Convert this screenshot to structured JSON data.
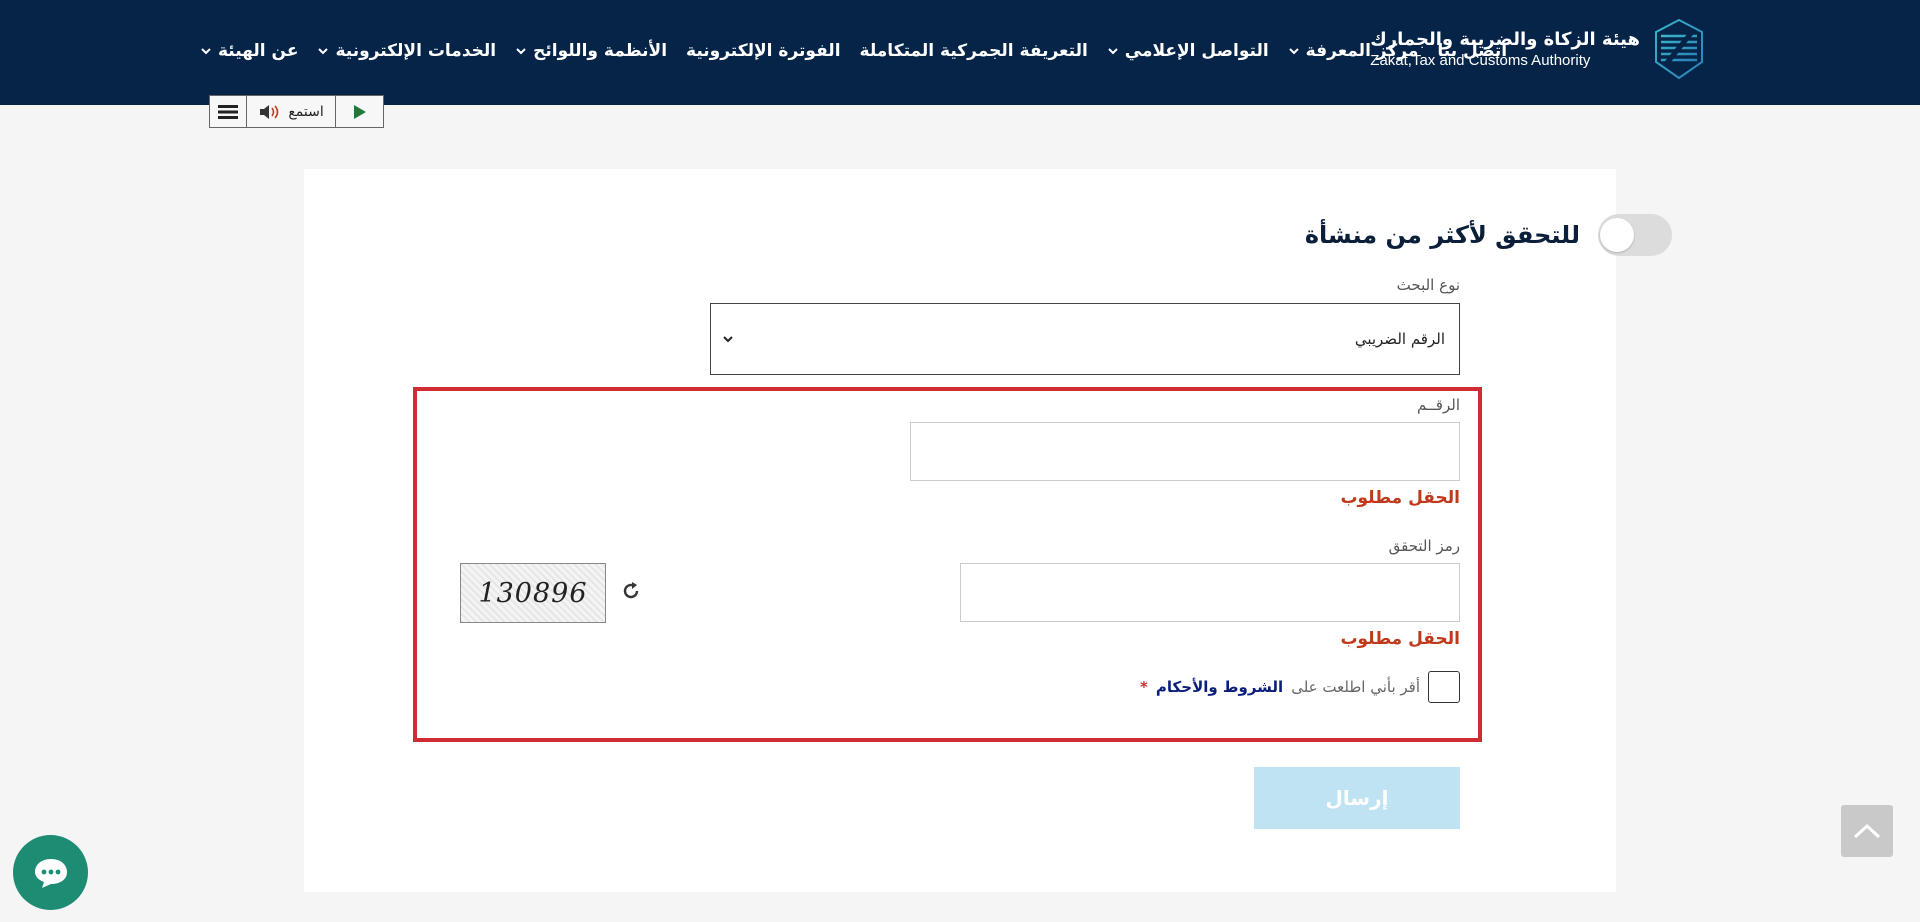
{
  "header": {
    "logo_ar": "هيئة الزكاة والضريبة والجمارك",
    "logo_en": "Zakat,Tax and Customs Authority",
    "nav": [
      {
        "label": "عن الهيئة",
        "dropdown": true
      },
      {
        "label": "الخدمات الإلكترونية",
        "dropdown": true
      },
      {
        "label": "الأنظمة واللوائح",
        "dropdown": true
      },
      {
        "label": "الفوترة الإلكترونية",
        "dropdown": false
      },
      {
        "label": "التعريفة الجمركية المتكاملة",
        "dropdown": false
      },
      {
        "label": "التواصل الإعلامي",
        "dropdown": true
      },
      {
        "label": "مركز المعرفة",
        "dropdown": true
      },
      {
        "label": "اتصل بنا",
        "dropdown": false
      }
    ]
  },
  "tts": {
    "listen_label": "استمع"
  },
  "form": {
    "toggle_label": "للتحقق لأكثر من منشأة",
    "search_type_label": "نوع البحث",
    "search_type_value": "الرقم الضريبي",
    "number_label": "الرقــم",
    "number_value": "",
    "number_error": "الحقل مطلوب",
    "captcha_label": "رمز التحقق",
    "captcha_value": "",
    "captcha_code": "130896",
    "captcha_error": "الحقل مطلوب",
    "terms_prefix": "أقر بأني اطلعت على",
    "terms_link": "الشروط والأحكام",
    "required_mark": "*",
    "submit_label": "إرسال"
  },
  "colors": {
    "header_bg": "#052447",
    "error": "#c0391b",
    "highlight": "#d12b33",
    "submit_disabled": "#bfe3f3",
    "chat": "#1e8b73"
  }
}
